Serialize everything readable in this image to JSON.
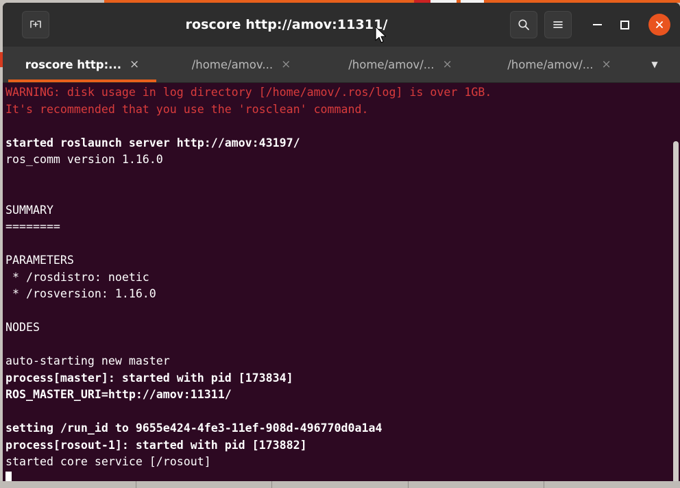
{
  "window": {
    "title": "roscore http://amov:11311/",
    "new_tab_label": "New Tab",
    "search_label": "Search",
    "menu_label": "Menu",
    "minimize_label": "Minimize",
    "maximize_label": "Maximize",
    "close_label": "Close",
    "titlebar_bg": "#2d2d2d",
    "close_button_color": "#e9541f"
  },
  "tabs": {
    "items": [
      {
        "label": "roscore http:...",
        "close": "×",
        "active": true
      },
      {
        "label": "/home/amov...",
        "close": "×",
        "active": false
      },
      {
        "label": "/home/amov/...",
        "close": "×",
        "active": false
      },
      {
        "label": "/home/amov/...",
        "close": "×",
        "active": false
      }
    ],
    "dropdown_glyph": "▼",
    "active_underline_color": "#e8601c",
    "bar_bg": "#383838"
  },
  "terminal": {
    "background": "#2d0922",
    "foreground": "#ffffff",
    "warning_color": "#d93c3c",
    "lines": [
      {
        "text": "WARNING: disk usage in log directory [/home/amov/.ros/log] is over 1GB.",
        "style": "warn"
      },
      {
        "text": "It's recommended that you use the 'rosclean' command.",
        "style": "warn"
      },
      {
        "text": "",
        "style": "plain"
      },
      {
        "text": "started roslaunch server http://amov:43197/",
        "style": "bold"
      },
      {
        "text": "ros_comm version 1.16.0",
        "style": "plain"
      },
      {
        "text": "",
        "style": "plain"
      },
      {
        "text": "",
        "style": "plain"
      },
      {
        "text": "SUMMARY",
        "style": "plain"
      },
      {
        "text": "========",
        "style": "plain"
      },
      {
        "text": "",
        "style": "plain"
      },
      {
        "text": "PARAMETERS",
        "style": "plain"
      },
      {
        "text": " * /rosdistro: noetic",
        "style": "plain"
      },
      {
        "text": " * /rosversion: 1.16.0",
        "style": "plain"
      },
      {
        "text": "",
        "style": "plain"
      },
      {
        "text": "NODES",
        "style": "plain"
      },
      {
        "text": "",
        "style": "plain"
      },
      {
        "text": "auto-starting new master",
        "style": "plain"
      },
      {
        "text": "process[master]: started with pid [173834]",
        "style": "bold"
      },
      {
        "text": "ROS_MASTER_URI=http://amov:11311/",
        "style": "bold"
      },
      {
        "text": "",
        "style": "plain"
      },
      {
        "text": "setting /run_id to 9655e424-4fe3-11ef-908d-496770d0a1a4",
        "style": "bold"
      },
      {
        "text": "process[rosout-1]: started with pid [173882]",
        "style": "bold"
      },
      {
        "text": "started core service [/rosout]",
        "style": "plain"
      }
    ]
  },
  "scrollbar": {
    "thumb_color": "#cfcbc7"
  }
}
